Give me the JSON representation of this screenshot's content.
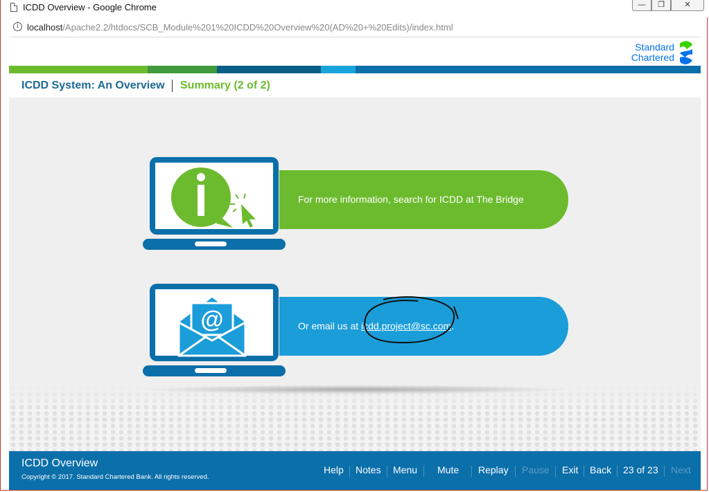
{
  "window": {
    "title": "ICDD Overview - Google Chrome",
    "controls": {
      "minimize": "—",
      "maximize": "❐",
      "close": "✕"
    }
  },
  "address_bar": {
    "info_icon": "info-icon",
    "host": "localhost",
    "path": "/Apache2.2/htdocs/SCB_Module%201%20ICDD%20Overview%20(AD%20+%20Edits)/index.html"
  },
  "header": {
    "brand_line1": "Standard",
    "brand_line2": "Chartered"
  },
  "subheader": {
    "course_title": "ICDD System: An Overview",
    "section_title": "Summary (2 of 2)"
  },
  "cards": [
    {
      "icon": "info-icon",
      "text": "For more information, search for ICDD at The Bridge"
    },
    {
      "icon": "email-icon",
      "text_prefix": "Or email us at ",
      "link": "icdd.project@sc.com",
      "text_suffix": "."
    }
  ],
  "footer": {
    "title": "ICDD Overview",
    "copyright": "Copyright © 2017. Standard Chartered Bank. All rights reserved.",
    "nav": {
      "help": "Help",
      "notes": "Notes",
      "menu": "Menu",
      "mute": "Mute",
      "replay": "Replay",
      "pause": "Pause",
      "exit": "Exit",
      "back": "Back",
      "page_counter": "23 of 23",
      "next": "Next"
    }
  },
  "colors": {
    "brand_blue": "#0473ea",
    "green": "#6cbb2e",
    "light_blue": "#1a9dd9",
    "dark_blue": "#0b6faa"
  }
}
